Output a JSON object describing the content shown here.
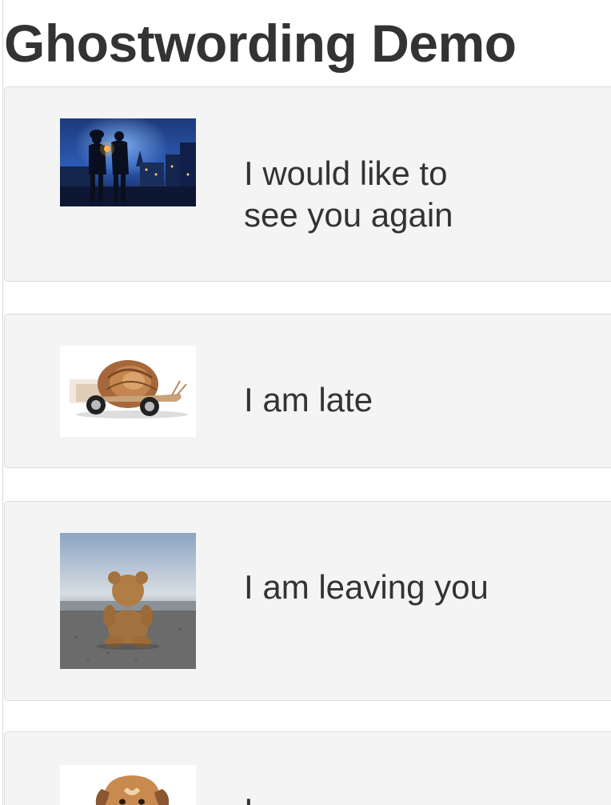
{
  "page": {
    "title": "Ghostwording Demo"
  },
  "cards": [
    {
      "caption": "I would like to see you again",
      "image": "couple-at-night-street-photo"
    },
    {
      "caption": "I am late",
      "image": "snail-on-wheels-photo"
    },
    {
      "caption": "I am leaving you",
      "image": "teddy-bear-sitting-alone-photo"
    },
    {
      "caption": "I",
      "image": "dog-face-photo"
    }
  ]
}
